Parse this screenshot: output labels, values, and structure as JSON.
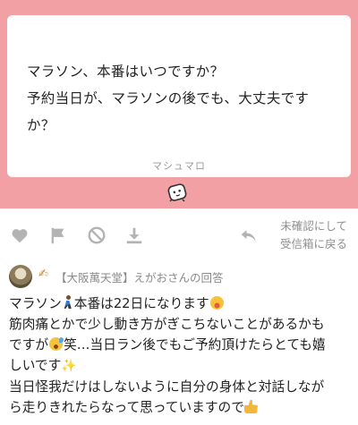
{
  "question": {
    "lines": [
      "マラソン、本番はいつですか？",
      "予約当日が、マラソンの後でも、大丈夫です",
      "か？"
    ],
    "brand": "マシュマロ"
  },
  "actions": {
    "icons": [
      "heart-icon",
      "flag-icon",
      "block-icon",
      "download-icon"
    ],
    "return_label_line1": "未確認にして",
    "return_label_line2": "受信箱に戻る"
  },
  "answer": {
    "responder": "【大阪萬天堂】えがおさんの回答",
    "line1_a": "マラソン",
    "line1_b": "本番は22日になります",
    "line2": "筋肉痛とかで少し動き方がぎこちないことがあるかも",
    "line3_a": "ですが",
    "line3_b": "笑…当日ラン後でもご予約頂けたらとても嬉",
    "line4": "しいです",
    "line5": "当日怪我だけはしないように自分の身体と対話しなが",
    "line6": "ら走りきれたらなって思っていますので"
  },
  "colors": {
    "pink_band": "#f2a0a3",
    "muted_text": "#8e8e8e",
    "icon_gray": "#b3b3b3"
  }
}
